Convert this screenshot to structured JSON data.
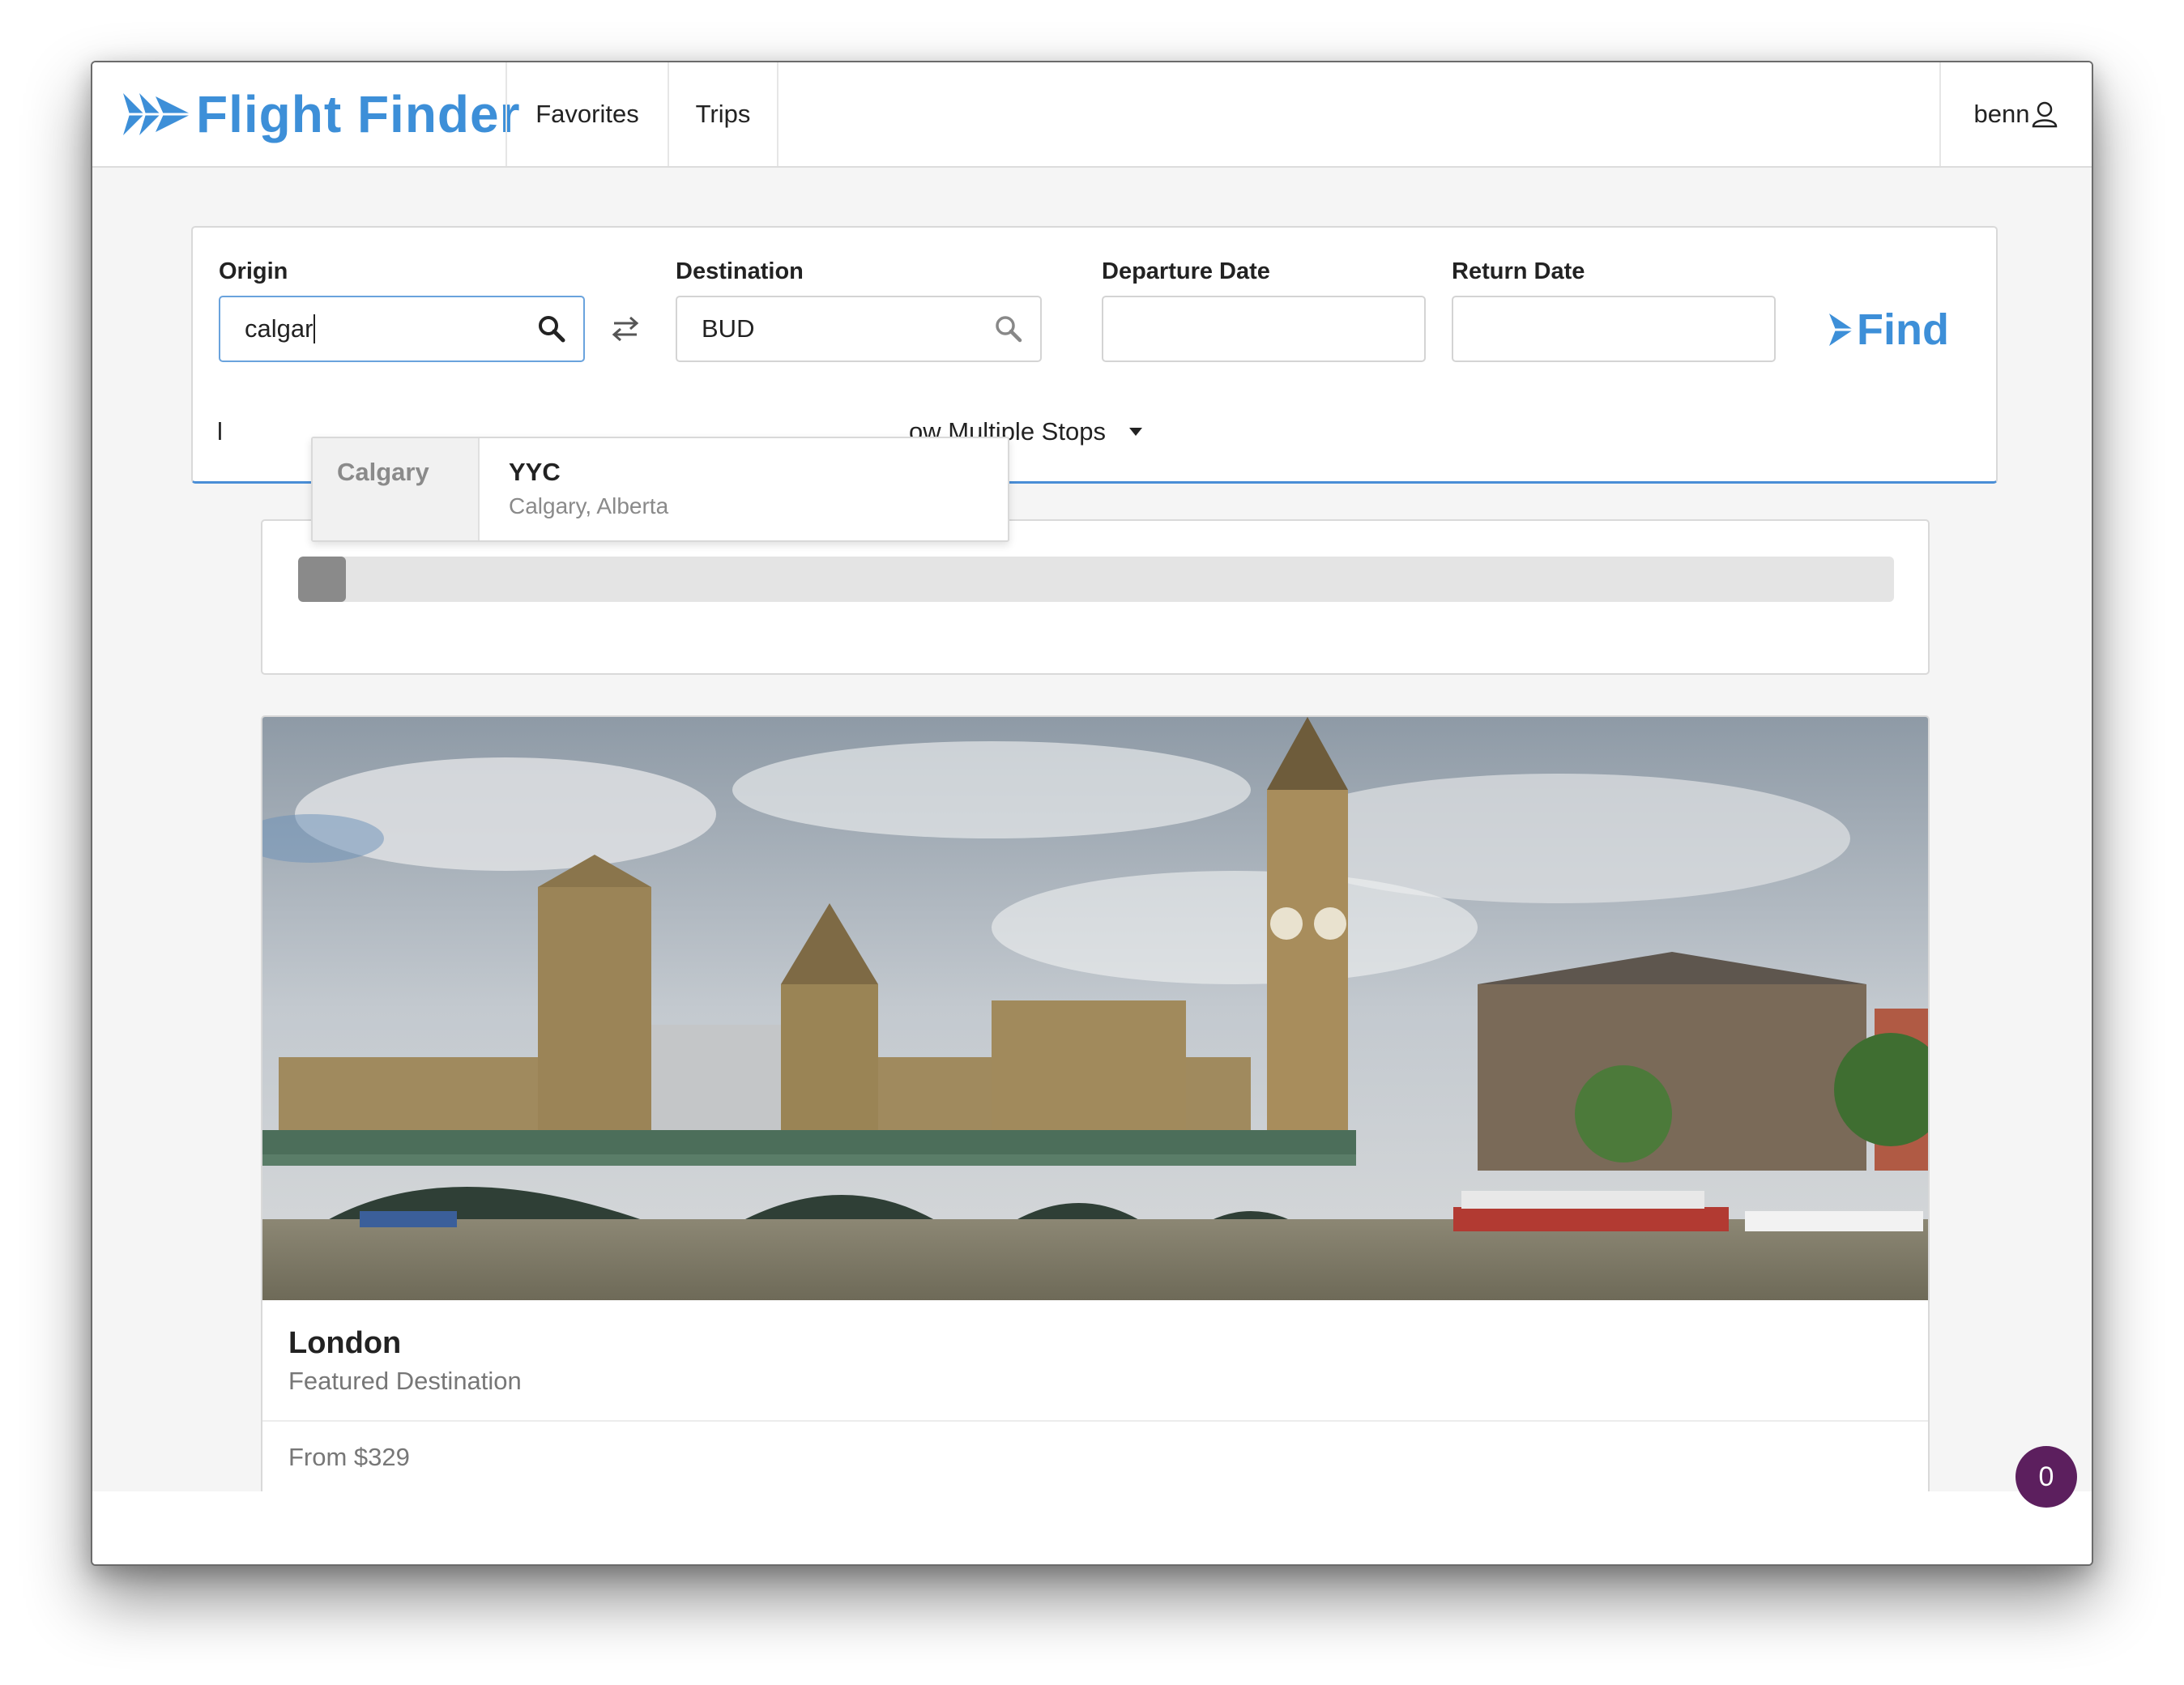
{
  "navbar": {
    "brand": "Flight Finder",
    "links": [
      "Favorites",
      "Trips"
    ],
    "user": "benn"
  },
  "search": {
    "origin_label": "Origin",
    "origin_value": "calgar",
    "destination_label": "Destination",
    "destination_value": "BUD",
    "departure_label": "Departure Date",
    "departure_value": "",
    "return_label": "Return Date",
    "return_value": "",
    "find_label": "Find",
    "stops_label": "ow Multiple Stops",
    "hidden_prefix": "l"
  },
  "autocomplete": {
    "group": "Calgary",
    "options": [
      {
        "code": "YYC",
        "city": "Calgary, Alberta"
      }
    ]
  },
  "progress": {
    "value": 0.03
  },
  "featured": {
    "title": "London",
    "subtitle": "Featured Destination",
    "price": "From $329"
  },
  "badge": {
    "count": "0"
  },
  "colors": {
    "brand": "#3d8fd8",
    "badge": "#5c1f5e",
    "progress_fill": "#8a8a8a"
  },
  "icons": [
    "plane-logo-icon",
    "user-icon",
    "search-icon",
    "swap-icon",
    "caret-down-icon"
  ]
}
